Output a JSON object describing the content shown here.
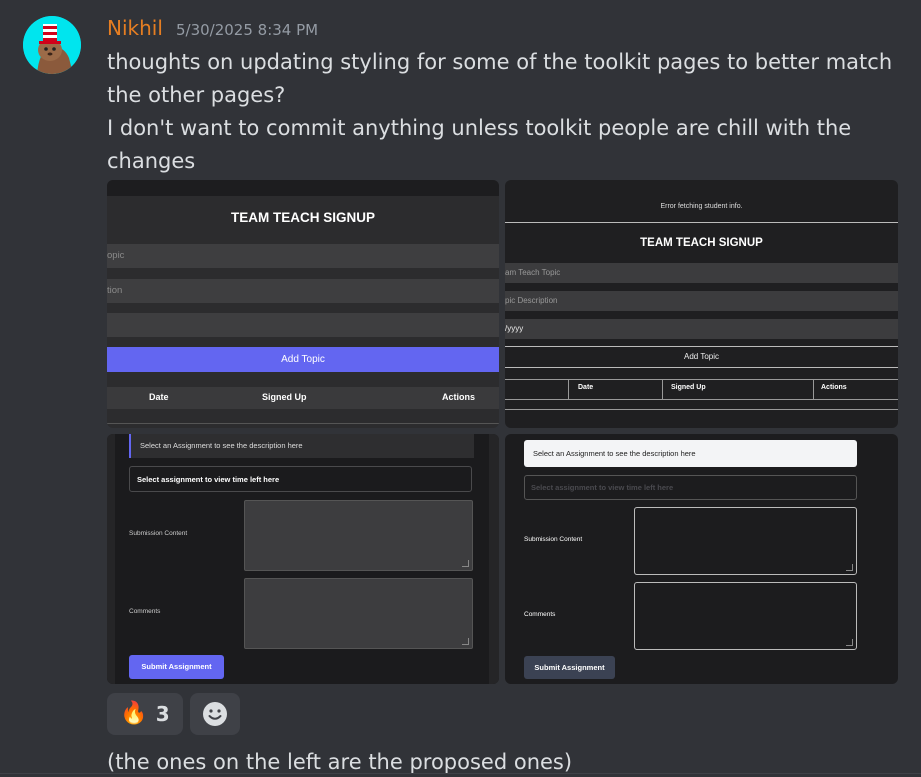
{
  "message": {
    "username": "Nikhil",
    "timestamp": "5/30/2025 8:34 PM",
    "lines": [
      "thoughts on updating styling for some of the toolkit pages to better match the other pages?",
      "I don't want to commit anything unless toolkit people are chill with the changes"
    ]
  },
  "screenshots": {
    "img1": {
      "title": "TEAM TEACH SIGNUP",
      "field1": "opic",
      "field2": "tion",
      "button": "Add Topic",
      "columns": [
        "Date",
        "Signed Up",
        "Actions"
      ]
    },
    "img2": {
      "error": "Error fetching student info.",
      "title": "TEAM TEACH SIGNUP",
      "field1": "am Teach Topic",
      "field2": "pic Description",
      "field3": "/yyyy",
      "button": "Add Topic",
      "columns": [
        "Date",
        "Signed Up",
        "Actions"
      ]
    },
    "img3": {
      "desc": "Select an Assignment to see the description here",
      "time": "Select assignment to view time left here",
      "submission_label": "Submission Content",
      "comments_label": "Comments",
      "submit": "Submit Assignment"
    },
    "img4": {
      "desc": "Select an Assignment to see the description here",
      "time": "Select assignment to view time left here",
      "submission_label": "Submission Content",
      "comments_label": "Comments",
      "submit": "Submit Assignment"
    }
  },
  "reactions": [
    {
      "emoji": "🔥",
      "count": "3"
    },
    {
      "emoji": "add-reaction-icon"
    }
  ],
  "followup": "(the ones on the left are the proposed ones)",
  "colors": {
    "username": "#e67e22",
    "accent": "#6366f1",
    "background": "#313338"
  }
}
